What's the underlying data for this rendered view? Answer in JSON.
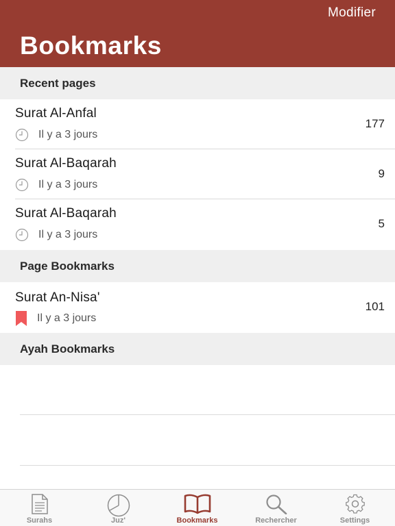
{
  "header": {
    "edit_label": "Modifier",
    "title": "Bookmarks",
    "background": "#973C31"
  },
  "sections": {
    "recent": {
      "title": "Recent pages",
      "rows": [
        {
          "title": "Surat Al-Anfal",
          "time": "Il y a 3 jours",
          "page": "177",
          "icon": "clock-icon"
        },
        {
          "title": "Surat Al-Baqarah",
          "time": "Il y a 3 jours",
          "page": "9",
          "icon": "clock-icon"
        },
        {
          "title": "Surat Al-Baqarah",
          "time": "Il y a 3 jours",
          "page": "5",
          "icon": "clock-icon"
        }
      ]
    },
    "page_bookmarks": {
      "title": "Page Bookmarks",
      "rows": [
        {
          "title": "Surat An-Nisa'",
          "time": "Il y a 3 jours",
          "page": "101",
          "icon": "bookmark-icon"
        }
      ]
    },
    "ayah_bookmarks": {
      "title": "Ayah Bookmarks",
      "rows": []
    }
  },
  "tabbar": {
    "active": "Bookmarks",
    "active_color": "#973C31",
    "items": [
      {
        "label": "Surahs",
        "icon": "document-icon"
      },
      {
        "label": "Juz'",
        "icon": "pie-icon"
      },
      {
        "label": "Bookmarks",
        "icon": "book-open-icon"
      },
      {
        "label": "Rechercher",
        "icon": "search-icon"
      },
      {
        "label": "Settings",
        "icon": "gear-icon"
      }
    ]
  }
}
